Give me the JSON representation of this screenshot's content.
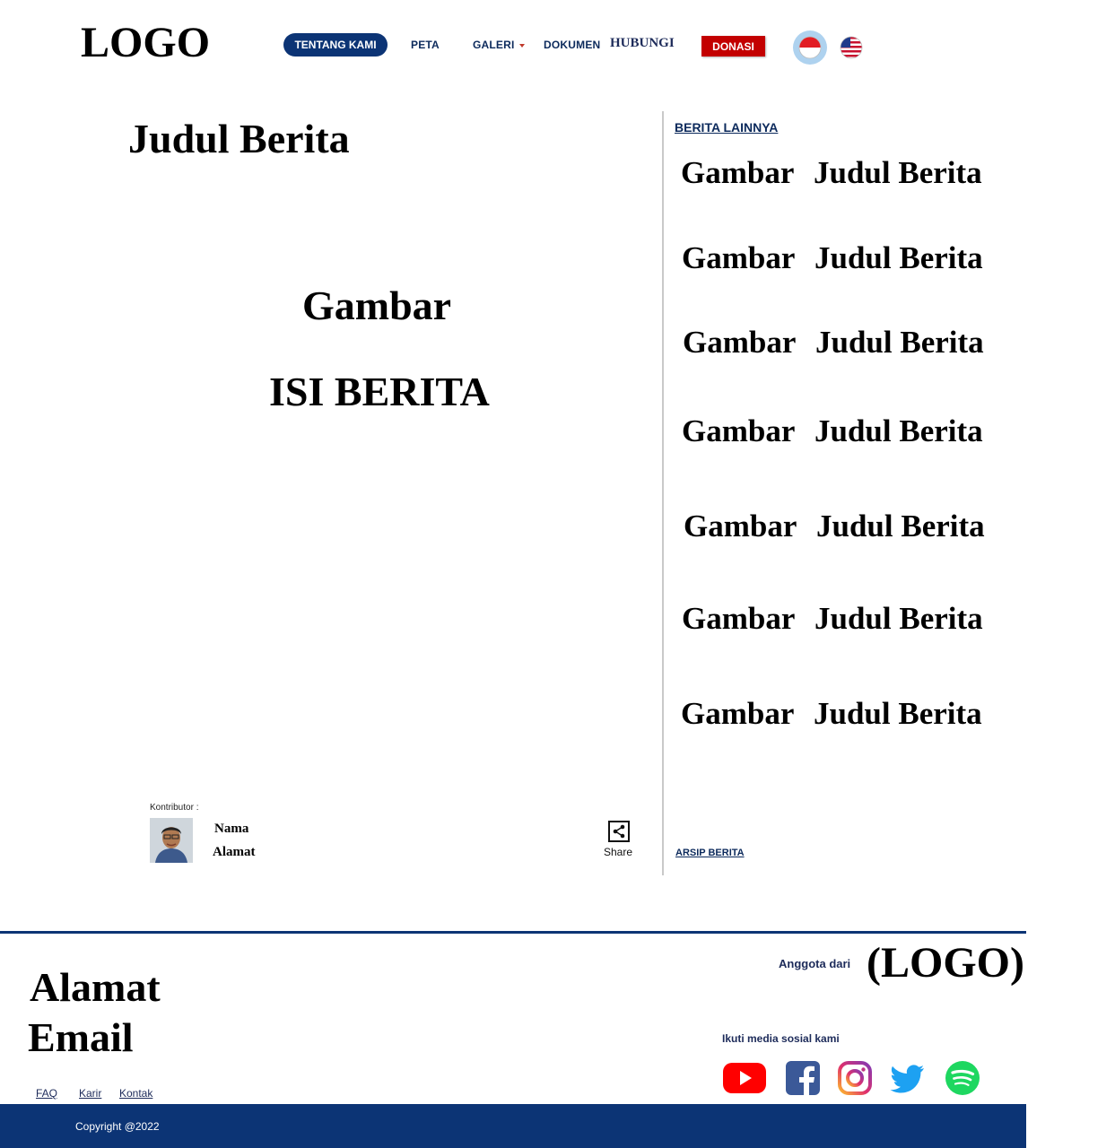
{
  "header": {
    "logo": "LOGO",
    "nav": [
      {
        "label": "TENTANG KAMI"
      },
      {
        "label": "PETA"
      },
      {
        "label": "GALERI"
      },
      {
        "label": "DOKUMEN"
      },
      {
        "label": "HUBUNGI"
      }
    ],
    "donate_label": "DONASI",
    "languages": [
      "indonesia-flag-icon",
      "us-flag-icon"
    ]
  },
  "article": {
    "title": "Judul Berita",
    "image_placeholder": "Gambar",
    "body": "ISI BERITA",
    "contributor_label": "Kontributor :",
    "contributor_name": "Nama",
    "contributor_address": "Alamat",
    "share_label": "Share"
  },
  "sidebar": {
    "heading": "BERITA LAINNYA",
    "items": [
      {
        "image": "Gambar",
        "title": "Judul Berita"
      },
      {
        "image": "Gambar",
        "title": "Judul Berita"
      },
      {
        "image": "Gambar",
        "title": "Judul Berita"
      },
      {
        "image": "Gambar",
        "title": "Judul Berita"
      },
      {
        "image": "Gambar",
        "title": "Judul Berita"
      },
      {
        "image": "Gambar",
        "title": "Judul Berita"
      },
      {
        "image": "Gambar",
        "title": "Judul Berita"
      }
    ],
    "archive_link": "ARSIP BERITA"
  },
  "footer": {
    "address": "Alamat",
    "email": "Email",
    "links": [
      "FAQ",
      "Karir",
      "Kontak"
    ],
    "member_of": "Anggota dari",
    "member_logo": "(LOGO)",
    "social_heading": "Ikuti media sosial kami",
    "social": [
      "youtube-icon",
      "facebook-icon",
      "instagram-icon",
      "twitter-icon",
      "spotify-icon"
    ],
    "copyright": "Copyright @2022"
  },
  "colors": {
    "primary": "#0c3475",
    "donate": "#c30000",
    "divider": "#c9c9c9"
  }
}
